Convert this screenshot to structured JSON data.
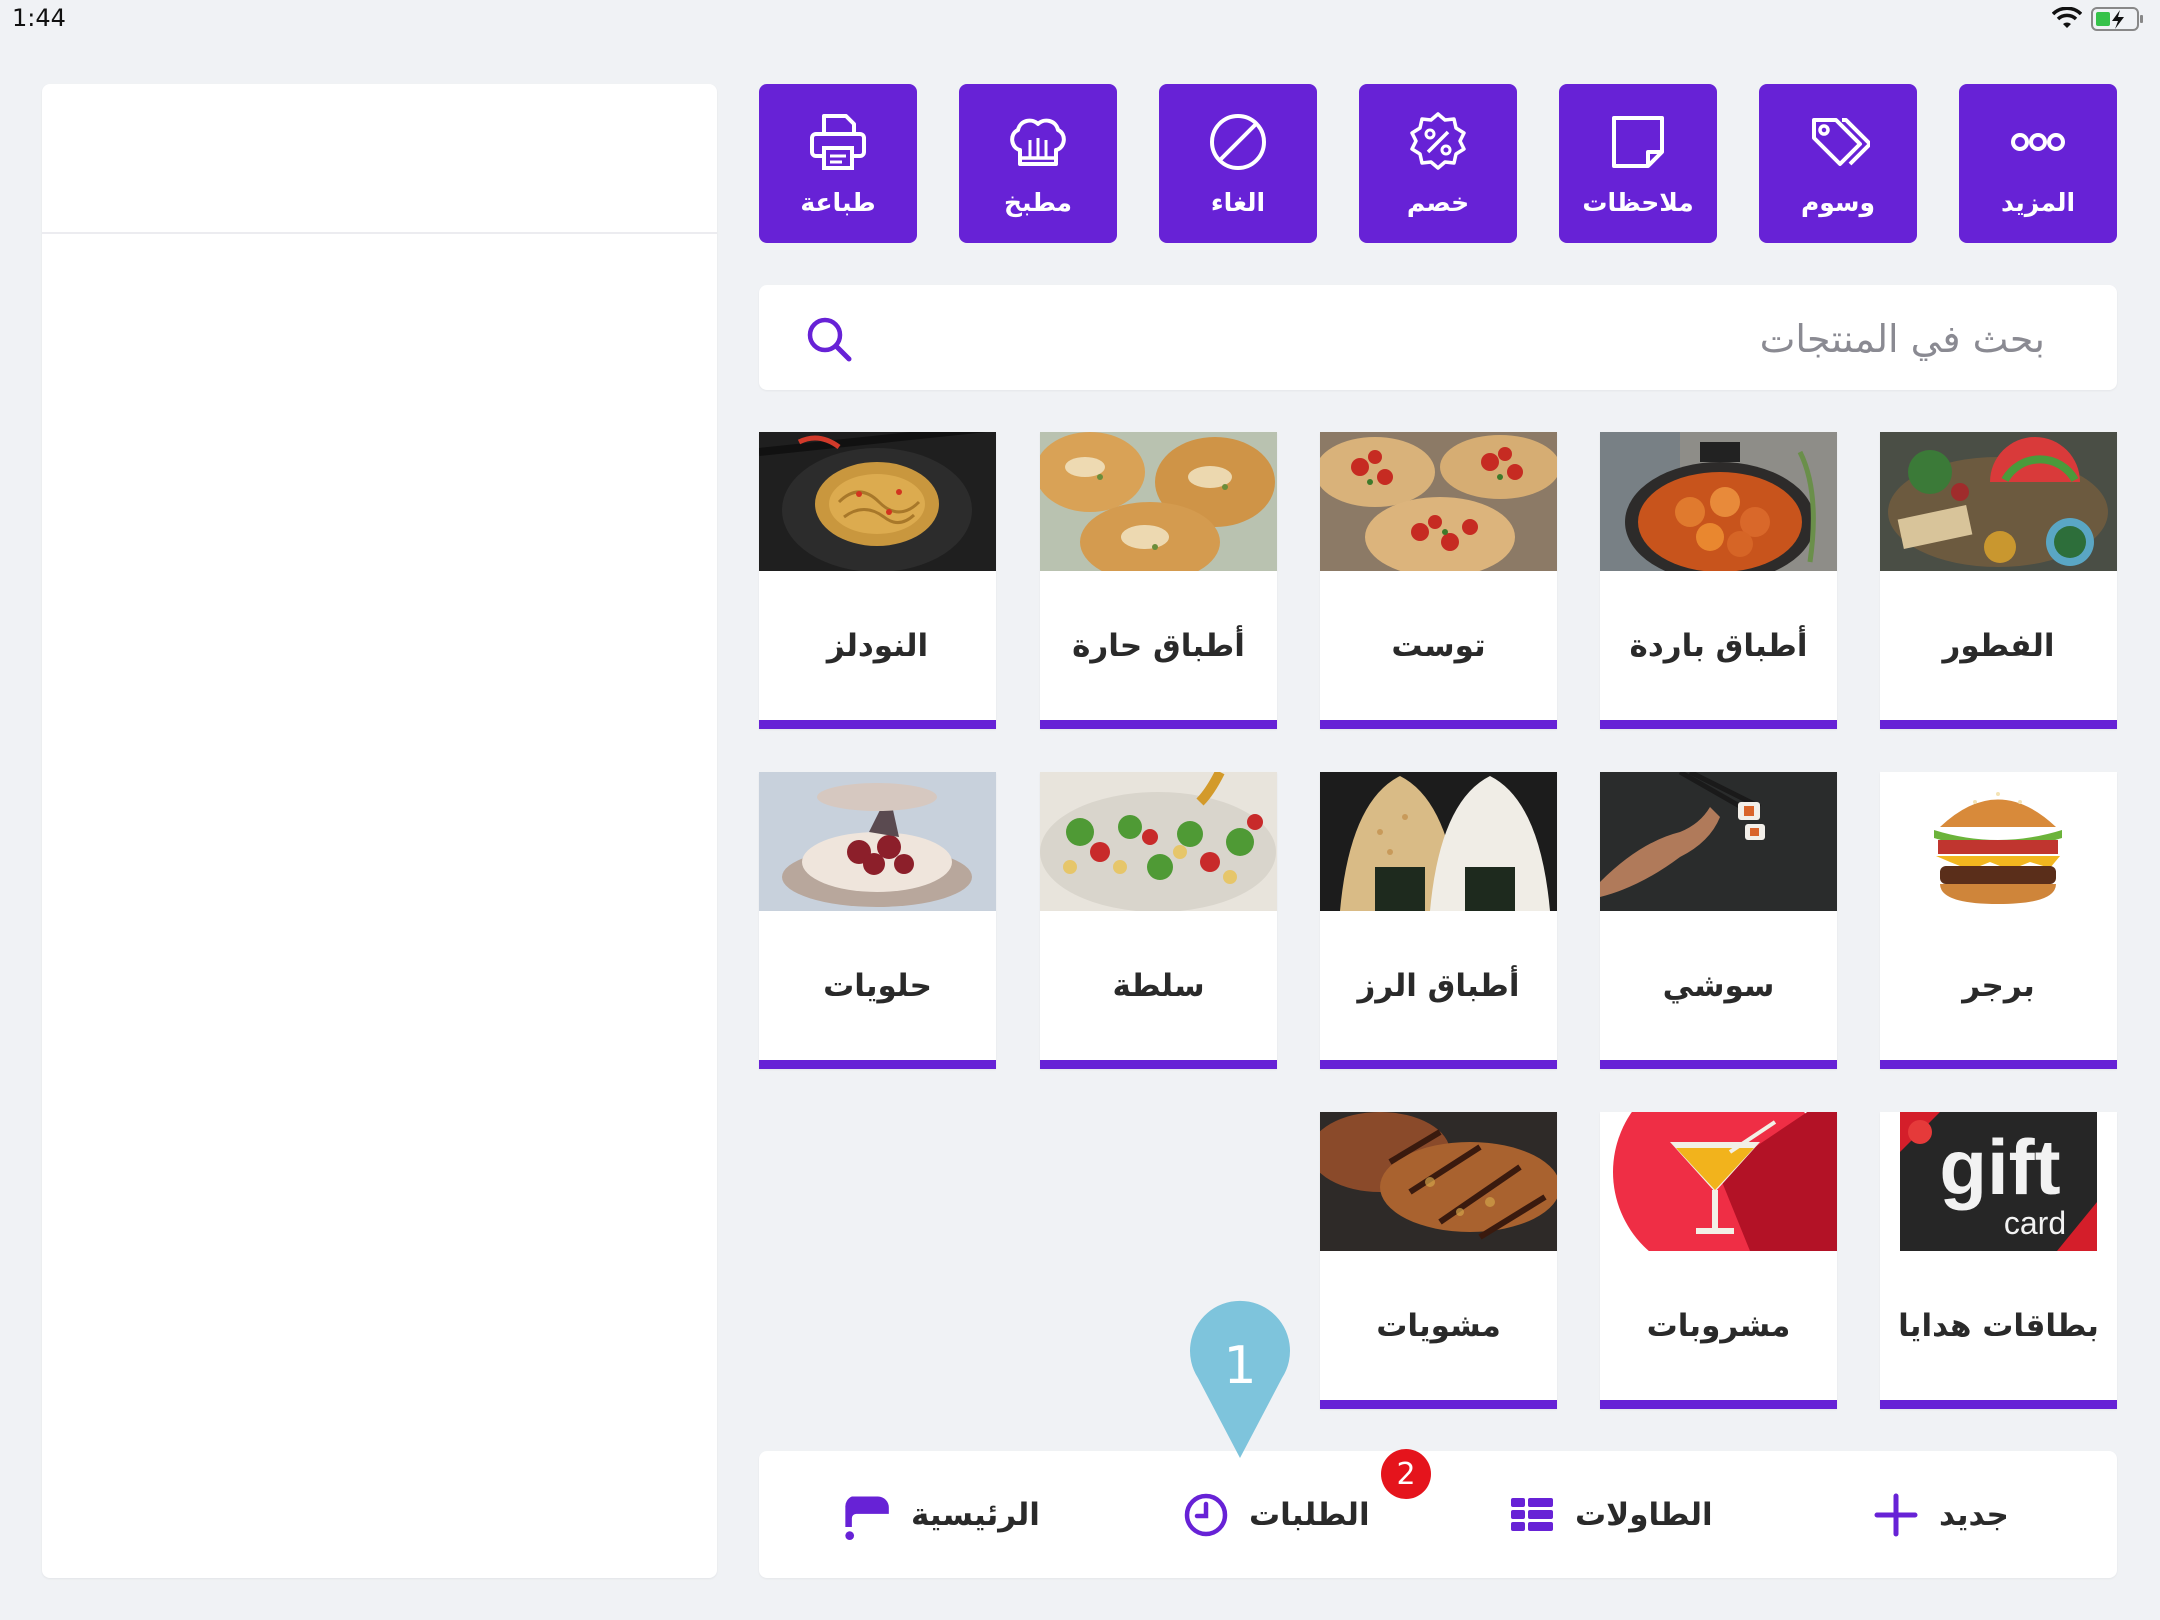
{
  "status": {
    "time": "1:44"
  },
  "actions": [
    {
      "label": "المزيد",
      "icon": "more-dots-icon"
    },
    {
      "label": "وسوم",
      "icon": "tags-icon"
    },
    {
      "label": "ملاحظات",
      "icon": "note-icon"
    },
    {
      "label": "خصم",
      "icon": "discount-icon"
    },
    {
      "label": "الغاء",
      "icon": "cancel-icon"
    },
    {
      "label": "مطبخ",
      "icon": "chef-hat-icon"
    },
    {
      "label": "طباعة",
      "icon": "printer-icon"
    }
  ],
  "search": {
    "placeholder": "بحث في المنتجات"
  },
  "categories": [
    {
      "name": "الفطور"
    },
    {
      "name": "أطباق باردة"
    },
    {
      "name": "توست"
    },
    {
      "name": "أطباق حارة"
    },
    {
      "name": "النودلز"
    },
    {
      "name": "برجر"
    },
    {
      "name": "سوشي"
    },
    {
      "name": "أطباق الرز"
    },
    {
      "name": "سلطة"
    },
    {
      "name": "حلويات"
    },
    {
      "name": "بطاقات هدايا",
      "image_text": {
        "big": "gift",
        "small": "card"
      }
    },
    {
      "name": "مشروبات"
    },
    {
      "name": "مشويات"
    }
  ],
  "nav": {
    "new_label": "جديد",
    "tables_label": "الطاولات",
    "orders_label": "الطلبات",
    "orders_badge": "2",
    "home_label": "الرئيسية"
  },
  "annotation": {
    "marker": "1"
  },
  "colors": {
    "accent": "#6722d6",
    "background": "#f0f2f5",
    "badge": "#e5141c",
    "marker": "#7ec4dc"
  }
}
